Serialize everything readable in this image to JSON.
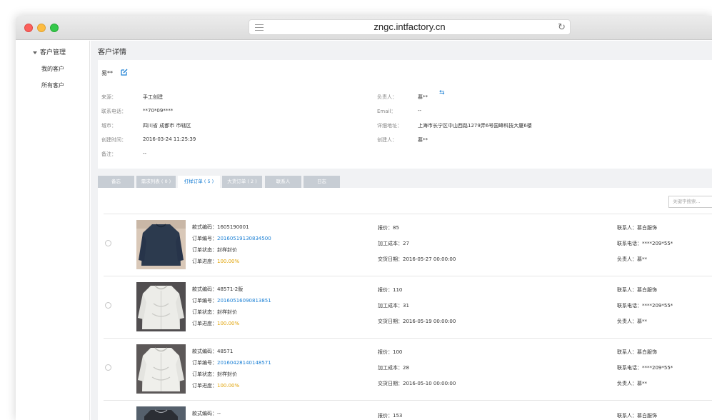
{
  "browser": {
    "url": "zngc.intfactory.cn"
  },
  "sidebar": {
    "group_label": "客户管理",
    "items": [
      {
        "label": "我的客户"
      },
      {
        "label": "所有客户"
      }
    ]
  },
  "page": {
    "title": "客户详情"
  },
  "customer": {
    "name": "易**",
    "fields": [
      {
        "label": "来源：",
        "value": "手工创建"
      },
      {
        "label": "联系电话：",
        "value": "**70*09****"
      },
      {
        "label": "城市：",
        "value": "四川省 成都市 市辖区"
      },
      {
        "label": "创建时间：",
        "value": "2016-03-24 11:25:39"
      },
      {
        "label": "备注：",
        "value": "--"
      },
      {
        "label": "负责人：",
        "value": "慕**"
      },
      {
        "label": "Email：",
        "value": "--"
      },
      {
        "label": "详细地址：",
        "value": "上海市长宁区中山西路1279弄6号国峰科技大厦6楼"
      },
      {
        "label": "创建人：",
        "value": "慕**"
      }
    ]
  },
  "tabs": [
    {
      "label": "备忘"
    },
    {
      "label": "需求列表 ( 0 )"
    },
    {
      "label": "打样订单 ( 5 )"
    },
    {
      "label": "大货订单 ( 2 )"
    },
    {
      "label": "联系人"
    },
    {
      "label": "日志"
    }
  ],
  "search": {
    "placeholder": "关键字搜索..."
  },
  "orders": [
    {
      "style_code": "款式编码：1605190001",
      "order_no_label": "订单编号：",
      "order_no": "20160519130834500",
      "status": "订单状态：封样封价",
      "progress_label": "订单进度：",
      "progress": "100.00%",
      "quote": "报价：85",
      "cost": "加工成本：27",
      "delivery": "交货日期：2016-05-27 00:00:00",
      "contact": "联系人：慕白服饰",
      "phone": "联系电话：****209*55*",
      "owner": "负责人：慕**"
    },
    {
      "style_code": "款式编码：48571-2版",
      "order_no_label": "订单编号：",
      "order_no": "20160516090813851",
      "status": "订单状态：封样封价",
      "progress_label": "订单进度：",
      "progress": "100.00%",
      "quote": "报价：110",
      "cost": "加工成本：31",
      "delivery": "交货日期：2016-05-19 00:00:00",
      "contact": "联系人：慕白服饰",
      "phone": "联系电话：****209*55*",
      "owner": "负责人：慕**"
    },
    {
      "style_code": "款式编码：48571",
      "order_no_label": "订单编号：",
      "order_no": "20160428140148571",
      "status": "订单状态：封样封价",
      "progress_label": "订单进度：",
      "progress": "100.00%",
      "quote": "报价：100",
      "cost": "加工成本：28",
      "delivery": "交货日期：2016-05-10 00:00:00",
      "contact": "联系人：慕白服饰",
      "phone": "联系电话：****209*55*",
      "owner": "负责人：慕**"
    },
    {
      "style_code": "款式编码：--",
      "quote": "报价：153",
      "contact": "联系人：慕白服饰"
    }
  ],
  "colors": {
    "link": "#1a7fd4",
    "progress": "#e0a100",
    "tab_bg": "#c7cdd4"
  }
}
